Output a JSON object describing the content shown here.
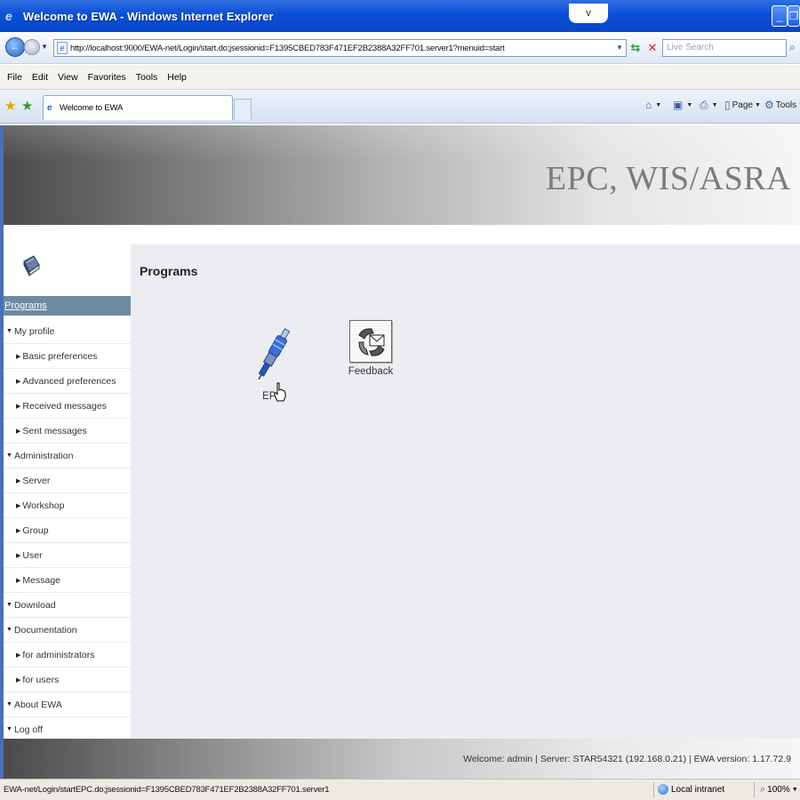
{
  "window": {
    "title": "Welcome to EWA - Windows Internet Explorer",
    "center_button": "v"
  },
  "address_bar": {
    "url": "http://localhost:9000/EWA-net/Login/start.do;jsessionid=F1395CBED783F471EF2B2388A32FF701.server1?menuid=start",
    "search_placeholder": "Live Search"
  },
  "menu_bar": [
    "File",
    "Edit",
    "View",
    "Favorites",
    "Tools",
    "Help"
  ],
  "tab": {
    "label": "Welcome to EWA"
  },
  "command_bar": {
    "page_label": "Page",
    "tools_label": "Tools"
  },
  "banner": {
    "title": "EPC, WIS/ASRA"
  },
  "sidebar": {
    "programs_link": "Programs",
    "items": [
      {
        "label": "My profile",
        "level": 0
      },
      {
        "label": "Basic preferences",
        "level": 1
      },
      {
        "label": "Advanced preferences",
        "level": 1
      },
      {
        "label": "Received messages",
        "level": 1
      },
      {
        "label": "Sent messages",
        "level": 1
      },
      {
        "label": "Administration",
        "level": 0
      },
      {
        "label": "Server",
        "level": 1
      },
      {
        "label": "Workshop",
        "level": 1
      },
      {
        "label": "Group",
        "level": 1
      },
      {
        "label": "User",
        "level": 1
      },
      {
        "label": "Message",
        "level": 1
      },
      {
        "label": "Download",
        "level": 0
      },
      {
        "label": "Documentation",
        "level": 0
      },
      {
        "label": "for administrators",
        "level": 1
      },
      {
        "label": "for users",
        "level": 1
      },
      {
        "label": "About EWA",
        "level": 0
      },
      {
        "label": "Log off",
        "level": 0
      }
    ]
  },
  "content": {
    "title": "Programs",
    "programs": [
      {
        "label": "EPC",
        "icon": "spark-plug-icon"
      },
      {
        "label": "Feedback",
        "icon": "feedback-mail-icon"
      }
    ]
  },
  "footer": {
    "text": "Welcome: admin | Server: STAR54321 (192.168.0.21) | EWA version: 1.17.72.9"
  },
  "status_bar": {
    "url": "EWA-net/Login/startEPC.do;jsessionid=F1395CBED783F471EF2B2388A32FF701.server1",
    "zone": "Local intranet",
    "zoom": "100%"
  }
}
